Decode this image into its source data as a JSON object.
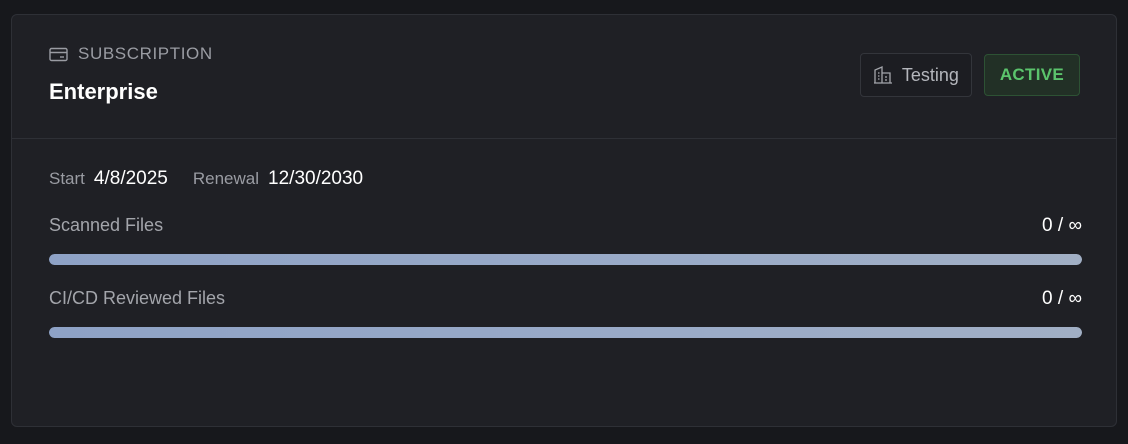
{
  "header": {
    "eyebrow": "SUBSCRIPTION",
    "plan_name": "Enterprise",
    "environment": "Testing",
    "status": "ACTIVE",
    "status_color": "#5bc46c"
  },
  "dates": {
    "start_label": "Start",
    "start_value": "4/8/2025",
    "renewal_label": "Renewal",
    "renewal_value": "12/30/2030"
  },
  "usage": [
    {
      "label": "Scanned Files",
      "value": "0 / ∞",
      "fill_fraction": 1.0
    },
    {
      "label": "CI/CD Reviewed Files",
      "value": "0 / ∞",
      "fill_fraction": 1.0
    }
  ],
  "icons": {
    "eyebrow_icon": "credit-card-icon",
    "environment_icon": "building-icon"
  },
  "colors": {
    "bar": "#94a6c6"
  }
}
